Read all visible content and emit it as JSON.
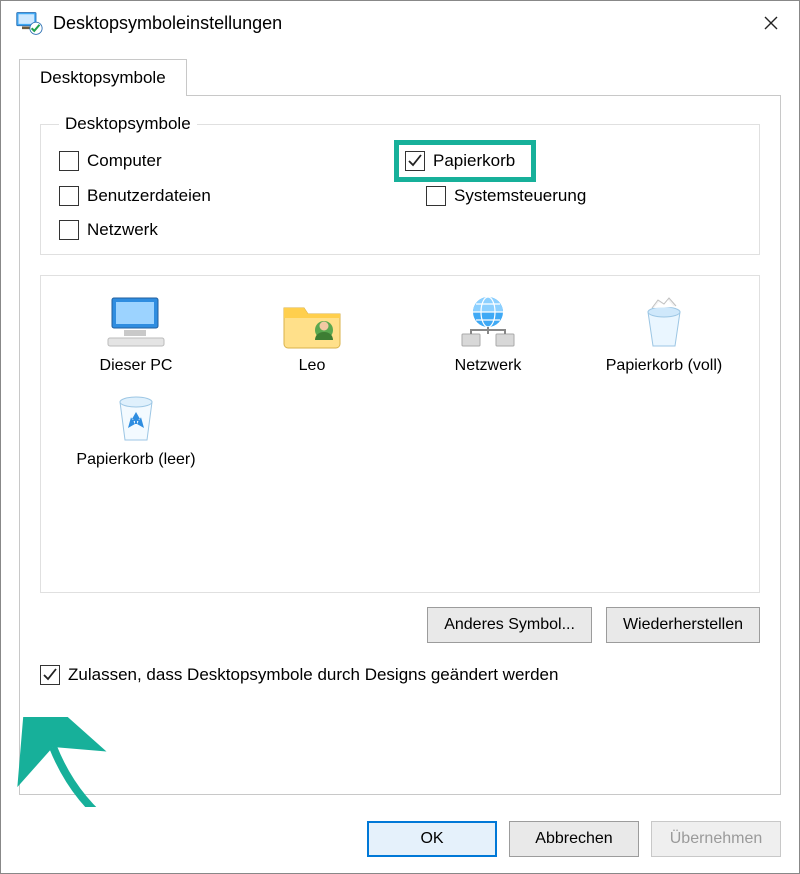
{
  "window": {
    "title": "Desktopsymboleinstellungen"
  },
  "tab": {
    "label": "Desktopsymbole"
  },
  "group": {
    "legend": "Desktopsymbole"
  },
  "checks": {
    "computer": {
      "label": "Computer",
      "checked": false
    },
    "papierkorb": {
      "label": "Papierkorb",
      "checked": true
    },
    "benutzerdateien": {
      "label": "Benutzerdateien",
      "checked": false
    },
    "systemsteuerung": {
      "label": "Systemsteuerung",
      "checked": false
    },
    "netzwerk": {
      "label": "Netzwerk",
      "checked": false
    }
  },
  "icons": {
    "dieserpc": "Dieser PC",
    "leo": "Leo",
    "netzwerk": "Netzwerk",
    "papierkorb_voll": "Papierkorb (voll)",
    "papierkorb_leer": "Papierkorb (leer)"
  },
  "buttons": {
    "change": "Anderes Symbol...",
    "restore": "Wiederherstellen",
    "ok": "OK",
    "cancel": "Abbrechen",
    "apply": "Übernehmen"
  },
  "allow": {
    "label": "Zulassen, dass Desktopsymbole durch Designs geändert werden",
    "checked": true
  }
}
